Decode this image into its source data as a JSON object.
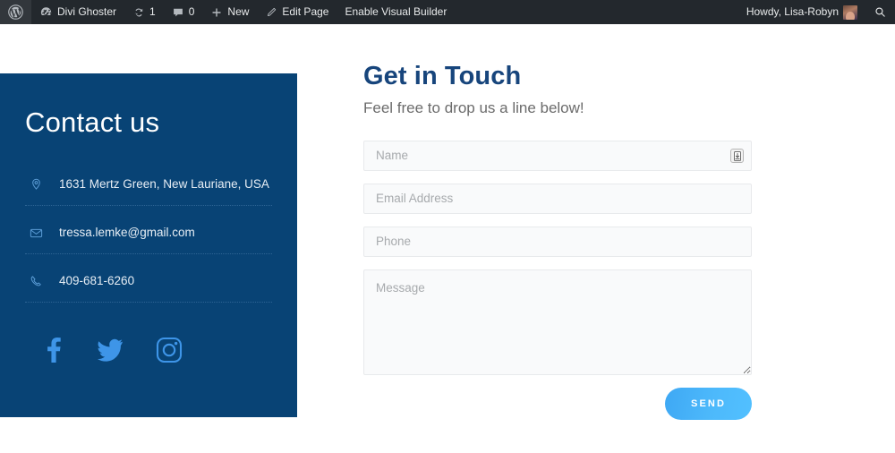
{
  "adminbar": {
    "wp_logo": "wordpress-logo-icon",
    "site_name": "Divi Ghoster",
    "site_icon": "dashboard-speedometer-icon",
    "updates_icon": "updates-refresh-icon",
    "updates_count": "1",
    "comments_icon": "comment-bubble-icon",
    "comments_count": "0",
    "new_icon": "plus-icon",
    "new_label": "New",
    "edit_icon": "pencil-icon",
    "edit_label": "Edit Page",
    "visual_builder_label": "Enable Visual Builder",
    "howdy": "Howdy, Lisa-Robyn",
    "avatar": "user-avatar",
    "search_icon": "search-icon",
    "background": "#23282d"
  },
  "contact": {
    "title": "Contact us",
    "panel_color": "#084375",
    "rows": [
      {
        "icon": "map-pin-icon",
        "text": "1631 Mertz Green, New Lauriane, USA"
      },
      {
        "icon": "envelope-icon",
        "text": "tressa.lemke@gmail.com"
      },
      {
        "icon": "phone-icon",
        "text": "409-681-6260"
      }
    ],
    "social": [
      {
        "icon": "facebook-icon",
        "label": "Facebook"
      },
      {
        "icon": "twitter-icon",
        "label": "Twitter"
      },
      {
        "icon": "instagram-icon",
        "label": "Instagram"
      }
    ]
  },
  "form": {
    "title": "Get in Touch",
    "title_color": "#17457c",
    "subtitle": "Feel free to drop us a line below!",
    "name": {
      "placeholder": "Name",
      "value": ""
    },
    "email": {
      "placeholder": "Email Address",
      "value": ""
    },
    "phone": {
      "placeholder": "Phone",
      "value": ""
    },
    "message": {
      "placeholder": "Message",
      "value": ""
    },
    "autofill_icon": "autofill-badge-icon",
    "send_label": "SEND",
    "send_color": "#4db9fb"
  }
}
